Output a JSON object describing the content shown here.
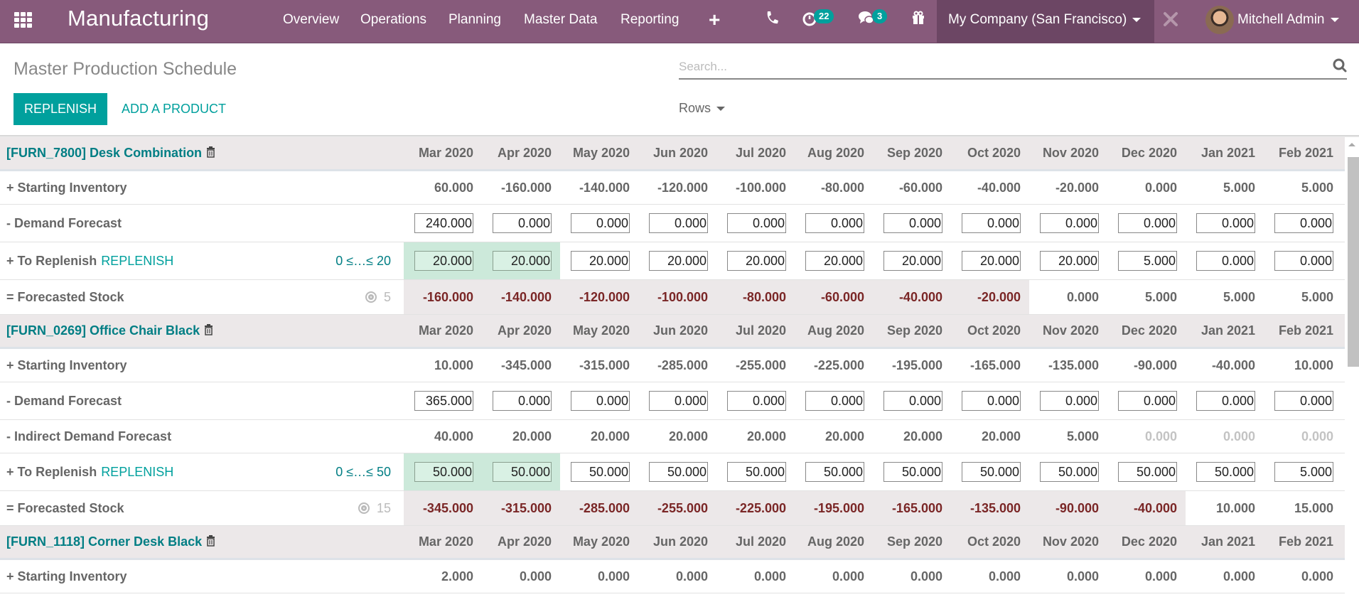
{
  "navbar": {
    "app_name": "Manufacturing",
    "menu": [
      "Overview",
      "Operations",
      "Planning",
      "Master Data",
      "Reporting"
    ],
    "activity_count": "22",
    "message_count": "3",
    "company": "My Company (San Francisco)",
    "user": "Mitchell Admin",
    "brand_color": "#875a7b",
    "accent_color": "#00a09d"
  },
  "control_panel": {
    "title": "Master Production Schedule",
    "replenish_label": "REPLENISH",
    "add_product_label": "ADD A PRODUCT",
    "search_placeholder": "Search...",
    "rows_label": "Rows"
  },
  "months": [
    "Mar 2020",
    "Apr 2020",
    "May 2020",
    "Jun 2020",
    "Jul 2020",
    "Aug 2020",
    "Sep 2020",
    "Oct 2020",
    "Nov 2020",
    "Dec 2020",
    "Jan 2021",
    "Feb 2021"
  ],
  "products": [
    {
      "name": "[FURN_7800] Desk Combination",
      "rows": [
        {
          "label": "+ Starting Inventory",
          "type": "text",
          "values": [
            "60.000",
            "-160.000",
            "-140.000",
            "-120.000",
            "-100.000",
            "-80.000",
            "-60.000",
            "-40.000",
            "-20.000",
            "0.000",
            "5.000",
            "5.000"
          ]
        },
        {
          "label": "- Demand Forecast",
          "type": "input",
          "values": [
            "240.000",
            "0.000",
            "0.000",
            "0.000",
            "0.000",
            "0.000",
            "0.000",
            "0.000",
            "0.000",
            "0.000",
            "0.000",
            "0.000"
          ]
        },
        {
          "label": "+ To Replenish",
          "type": "input",
          "replenish_link": "REPLENISH",
          "range": "0 ≤…≤ 20",
          "highlight_count": 2,
          "values": [
            "20.000",
            "20.000",
            "20.000",
            "20.000",
            "20.000",
            "20.000",
            "20.000",
            "20.000",
            "20.000",
            "5.000",
            "0.000",
            "0.000"
          ]
        },
        {
          "label": "= Forecasted Stock",
          "type": "stock",
          "safety_stock": "5",
          "values": [
            "-160.000",
            "-140.000",
            "-120.000",
            "-100.000",
            "-80.000",
            "-60.000",
            "-40.000",
            "-20.000",
            "0.000",
            "5.000",
            "5.000",
            "5.000"
          ]
        }
      ]
    },
    {
      "name": "[FURN_0269] Office Chair Black",
      "rows": [
        {
          "label": "+ Starting Inventory",
          "type": "text",
          "values": [
            "10.000",
            "-345.000",
            "-315.000",
            "-285.000",
            "-255.000",
            "-225.000",
            "-195.000",
            "-165.000",
            "-135.000",
            "-90.000",
            "-40.000",
            "10.000"
          ]
        },
        {
          "label": "- Demand Forecast",
          "type": "input",
          "values": [
            "365.000",
            "0.000",
            "0.000",
            "0.000",
            "0.000",
            "0.000",
            "0.000",
            "0.000",
            "0.000",
            "0.000",
            "0.000",
            "0.000"
          ]
        },
        {
          "label": "- Indirect Demand Forecast",
          "type": "text",
          "values": [
            "40.000",
            "20.000",
            "20.000",
            "20.000",
            "20.000",
            "20.000",
            "20.000",
            "20.000",
            "5.000",
            "0.000",
            "0.000",
            "0.000"
          ]
        },
        {
          "label": "+ To Replenish",
          "type": "input",
          "replenish_link": "REPLENISH",
          "range": "0 ≤…≤ 50",
          "highlight_count": 2,
          "values": [
            "50.000",
            "50.000",
            "50.000",
            "50.000",
            "50.000",
            "50.000",
            "50.000",
            "50.000",
            "50.000",
            "50.000",
            "50.000",
            "5.000"
          ]
        },
        {
          "label": "= Forecasted Stock",
          "type": "stock",
          "safety_stock": "15",
          "values": [
            "-345.000",
            "-315.000",
            "-285.000",
            "-255.000",
            "-225.000",
            "-195.000",
            "-165.000",
            "-135.000",
            "-90.000",
            "-40.000",
            "10.000",
            "15.000"
          ]
        }
      ]
    },
    {
      "name": "[FURN_1118] Corner Desk Black",
      "rows": [
        {
          "label": "+ Starting Inventory",
          "type": "text",
          "values": [
            "2.000",
            "0.000",
            "0.000",
            "0.000",
            "0.000",
            "0.000",
            "0.000",
            "0.000",
            "0.000",
            "0.000",
            "0.000",
            "0.000"
          ]
        }
      ]
    }
  ]
}
